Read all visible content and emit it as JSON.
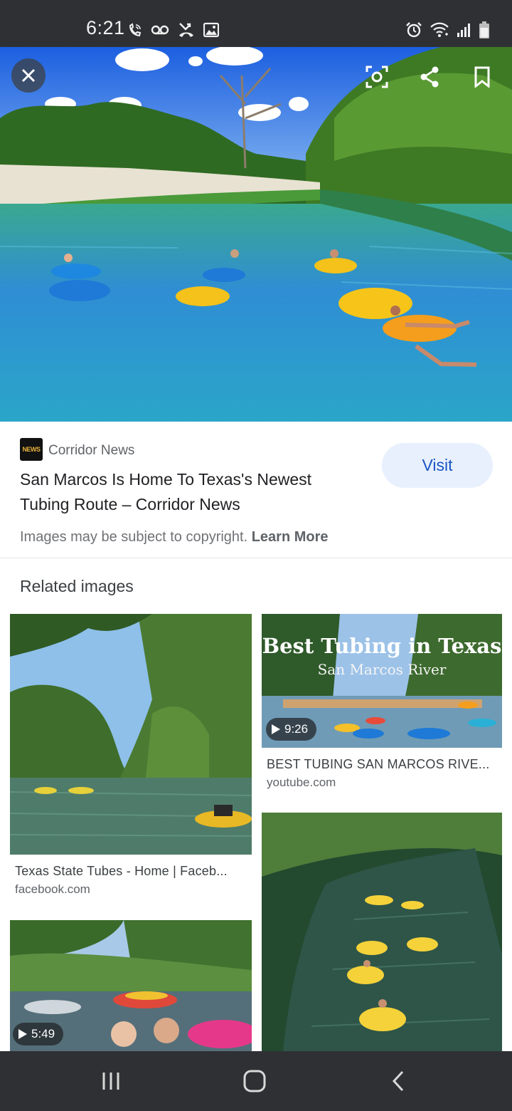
{
  "status_bar": {
    "time": "6:21",
    "left_icons": [
      "wifi-calling-icon",
      "voicemail-icon",
      "missed-call-icon",
      "gallery-icon"
    ],
    "right_icons": [
      "alarm-icon",
      "wifi-icon",
      "signal-icon",
      "battery-icon"
    ]
  },
  "hero": {
    "close_icon": "close-icon",
    "actions": [
      "lens-icon",
      "share-icon",
      "bookmark-icon"
    ]
  },
  "source": {
    "favicon_text": "NEWS",
    "name": "Corridor News",
    "title": "San Marcos Is Home To Texas's Newest Tubing Route – Corridor News",
    "visit_label": "Visit",
    "copyright_text": "Images may be subject to copyright.",
    "learn_more": "Learn More"
  },
  "related": {
    "heading": "Related images",
    "cards": [
      {
        "title": "Texas State Tubes - Home | Faceb...",
        "domain": "facebook.com"
      },
      {
        "title": "BEST TUBING SAN MARCOS RIVE...",
        "domain": "youtube.com",
        "duration": "9:26",
        "overlay_title": "Best Tubing in Texas",
        "overlay_subtitle": "San Marcos River"
      },
      {
        "title": "",
        "domain": ""
      },
      {
        "title": "",
        "domain": "",
        "duration": "5:49"
      }
    ]
  },
  "nav_bar": {
    "buttons": [
      "recent-apps-icon",
      "home-icon",
      "back-icon"
    ]
  },
  "colors": {
    "status_bg": "#2f3034",
    "visit_bg": "#e8f0fe",
    "visit_text": "#1a56c4"
  }
}
